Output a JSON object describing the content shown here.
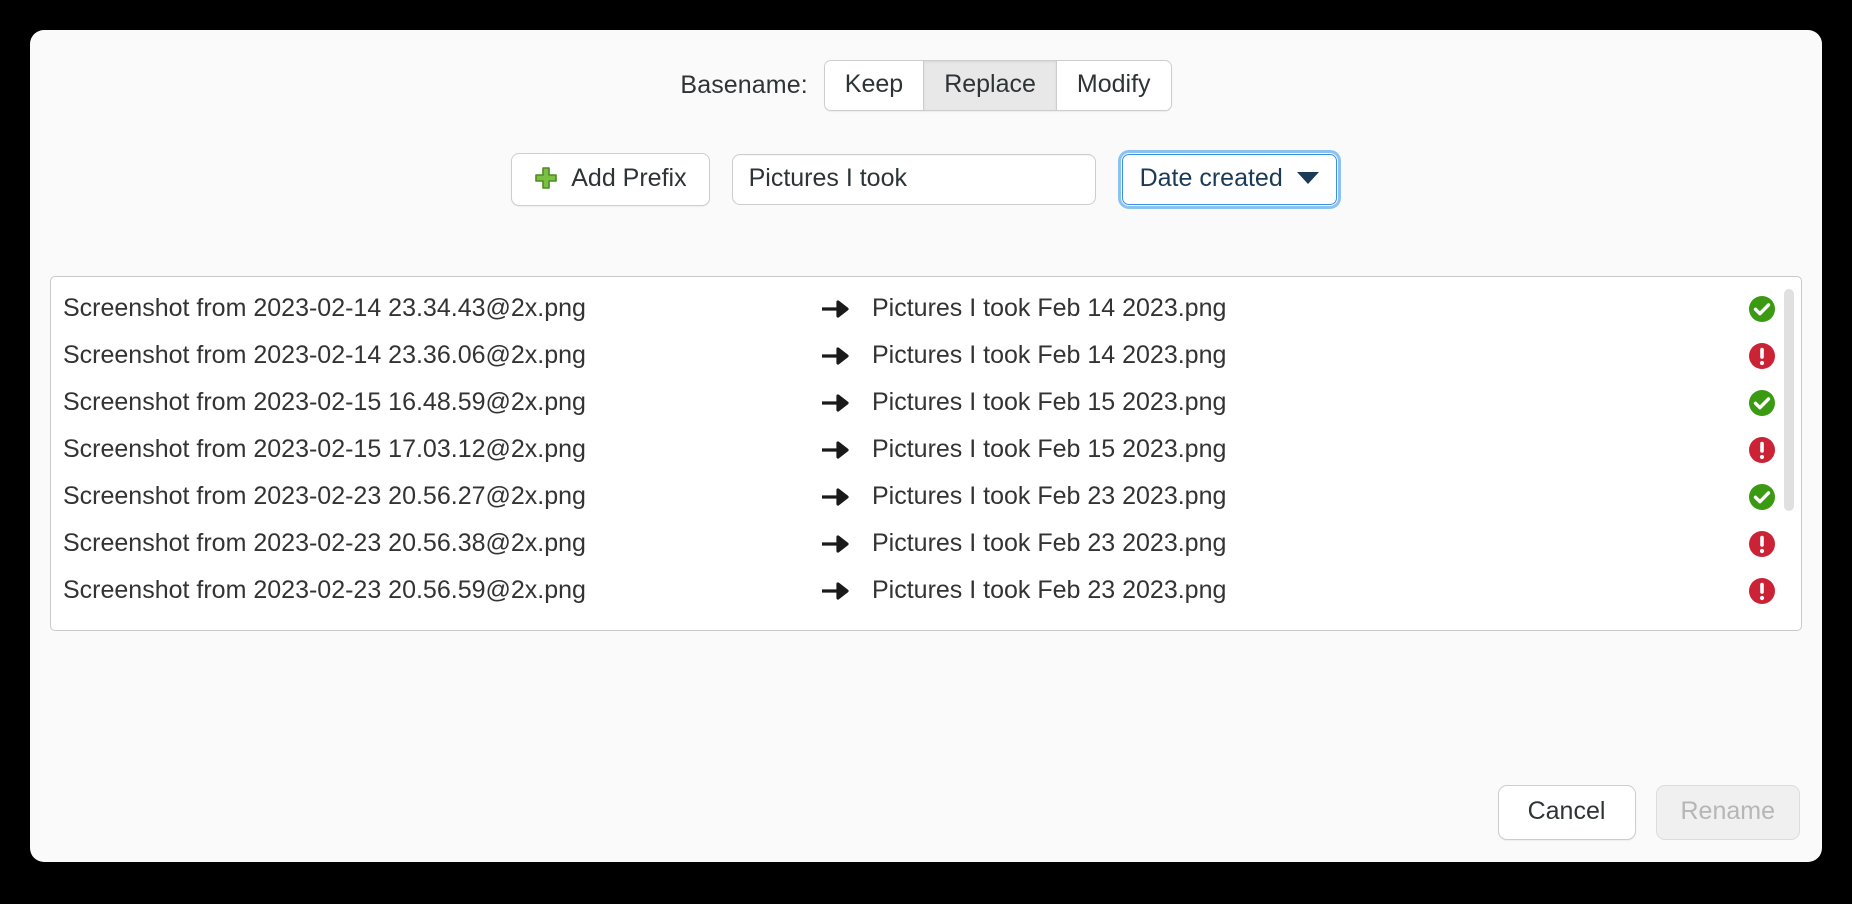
{
  "dialog": {
    "basename": {
      "label": "Basename:",
      "options": [
        {
          "label": "Keep",
          "selected": false
        },
        {
          "label": "Replace",
          "selected": true
        },
        {
          "label": "Modify",
          "selected": false
        }
      ]
    },
    "prefix": {
      "add_button_label": "Add Prefix",
      "plus_icon": "plus-icon",
      "input_value": "Pictures I took",
      "input_placeholder": "",
      "dropdown_value": "Date created",
      "dropdown_icon": "chevron-down-icon"
    },
    "list": {
      "arrow_icon": "arrow-right-icon",
      "status_icons": {
        "ok": "check-circle-icon",
        "conflict": "error-circle-icon"
      },
      "colors": {
        "ok": "#3a9a11",
        "conflict": "#cc2236",
        "plus": "#73b534",
        "focus_ring": "#8cc2f2",
        "dropdown_text": "#1b3a57"
      },
      "rows": [
        {
          "old_name": "Screenshot from 2023-02-14 23.34.43@2x.png",
          "new_name": "Pictures I took Feb 14 2023.png",
          "status": "ok"
        },
        {
          "old_name": "Screenshot from 2023-02-14 23.36.06@2x.png",
          "new_name": "Pictures I took Feb 14 2023.png",
          "status": "conflict"
        },
        {
          "old_name": "Screenshot from 2023-02-15 16.48.59@2x.png",
          "new_name": "Pictures I took Feb 15 2023.png",
          "status": "ok"
        },
        {
          "old_name": "Screenshot from 2023-02-15 17.03.12@2x.png",
          "new_name": "Pictures I took Feb 15 2023.png",
          "status": "conflict"
        },
        {
          "old_name": "Screenshot from 2023-02-23 20.56.27@2x.png",
          "new_name": "Pictures I took Feb 23 2023.png",
          "status": "ok"
        },
        {
          "old_name": "Screenshot from 2023-02-23 20.56.38@2x.png",
          "new_name": "Pictures I took Feb 23 2023.png",
          "status": "conflict"
        },
        {
          "old_name": "Screenshot from 2023-02-23 20.56.59@2x.png",
          "new_name": "Pictures I took Feb 23 2023.png",
          "status": "conflict"
        }
      ]
    },
    "footer": {
      "cancel_label": "Cancel",
      "rename_label": "Rename",
      "rename_disabled": true
    }
  }
}
